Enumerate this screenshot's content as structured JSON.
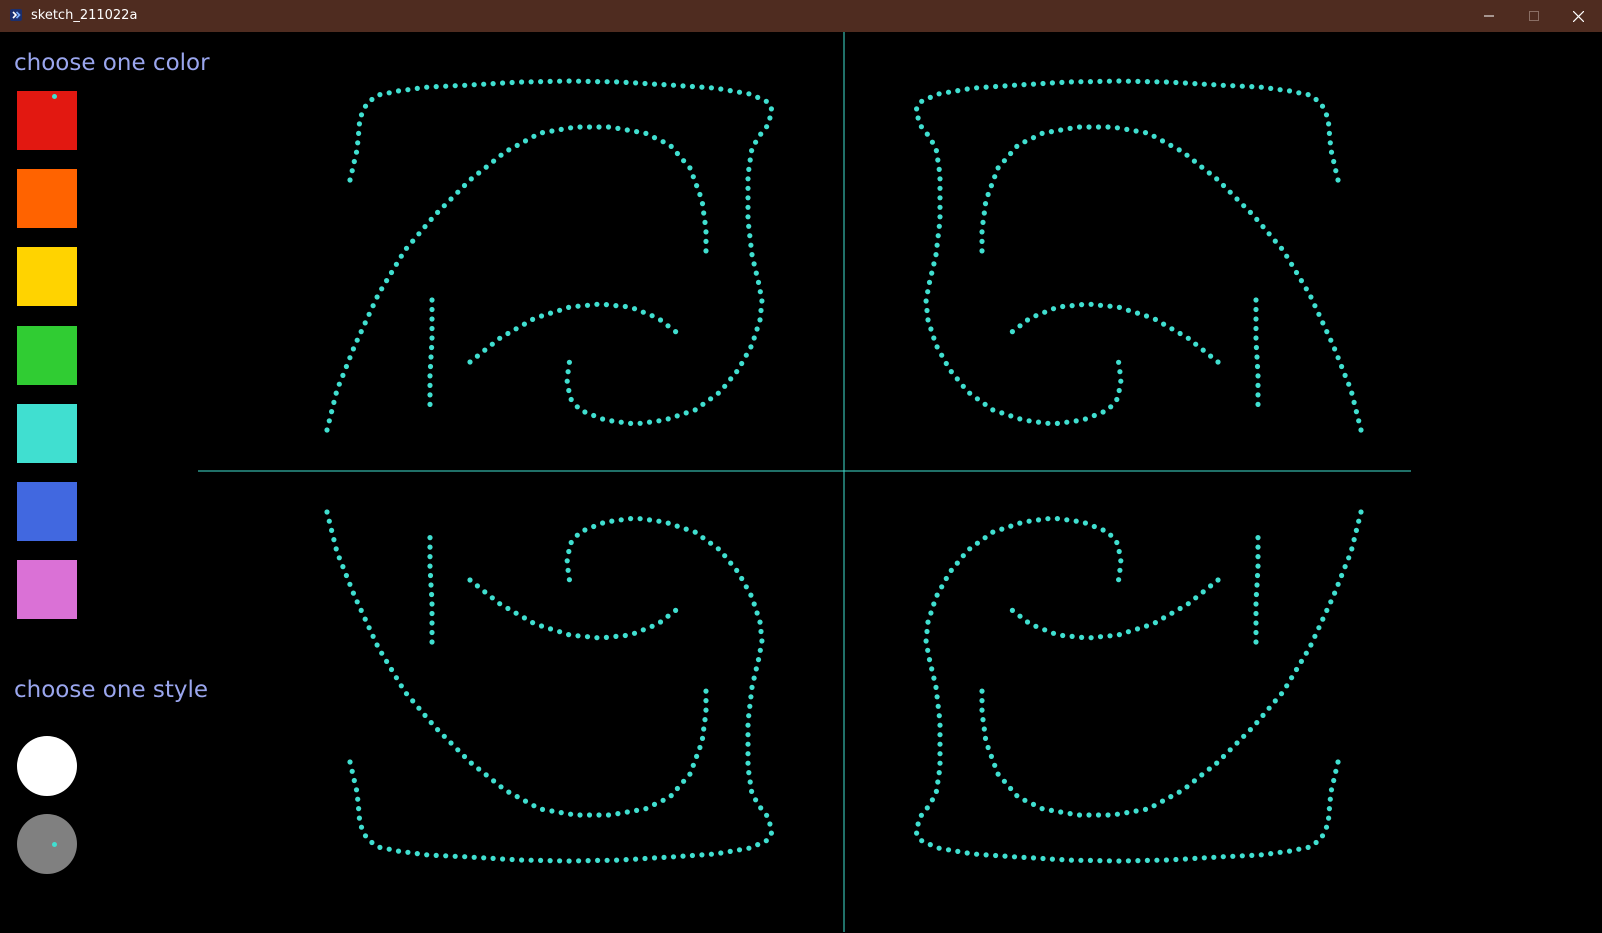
{
  "window": {
    "title": "sketch_211022a"
  },
  "palette": {
    "label": "choose one color",
    "colors": [
      {
        "name": "red",
        "hex": "#e21811"
      },
      {
        "name": "orange",
        "hex": "#ff6300"
      },
      {
        "name": "yellow",
        "hex": "#ffd300"
      },
      {
        "name": "green",
        "hex": "#30cc33"
      },
      {
        "name": "turquoise",
        "hex": "#40dfd0"
      },
      {
        "name": "royal-blue",
        "hex": "#4168e0"
      },
      {
        "name": "orchid",
        "hex": "#da71d6"
      }
    ],
    "selected_index": 0
  },
  "styles": {
    "label": "choose one style",
    "options": [
      {
        "name": "white-circle",
        "hex": "#ffffff"
      },
      {
        "name": "gray-circle",
        "hex": "#808080"
      }
    ],
    "selected_index": 1
  },
  "drawing": {
    "stroke_color": "#40dfd0",
    "guide_color": "#40dfd0",
    "symmetry": "four-way mirror"
  }
}
